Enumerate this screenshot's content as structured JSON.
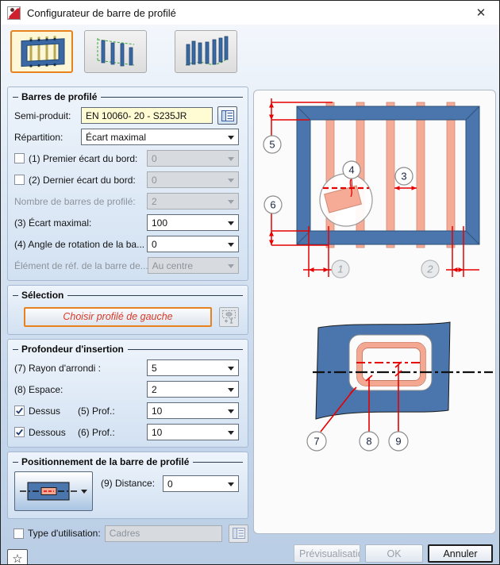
{
  "window": {
    "title": "Configurateur de barre de profilé"
  },
  "icons": {
    "close": "✕",
    "star": "☆"
  },
  "colors": {
    "accent_orange": "#E8821E",
    "frame_blue": "#4A76AD",
    "bar_pink": "#F6AB97",
    "dimension_red": "#E60000",
    "field_yellow": "#FFFBD2"
  },
  "form": {
    "group_bars": {
      "title": "Barres de profilé",
      "semi_product_label": "Semi-produit:",
      "semi_product_value": "EN 10060- 20 - S235JR",
      "repartition_label": "Répartition:",
      "repartition_value": "Écart maximal",
      "first_gap_label": "(1) Premier écart du bord:",
      "first_gap_value": "0",
      "last_gap_label": "(2) Dernier écart du bord:",
      "last_gap_value": "0",
      "count_label": "Nombre de barres de profilé:",
      "count_value": "2",
      "max_gap_label": "(3) Écart maximal:",
      "max_gap_value": "100",
      "angle_label": "(4) Angle de rotation de la ba...",
      "angle_value": "0",
      "ref_label": "Élément de réf. de la barre de...",
      "ref_value": "Au centre"
    },
    "group_selection": {
      "title": "Sélection",
      "choose_label": "Choisir profilé de gauche"
    },
    "group_depth": {
      "title": "Profondeur d'insertion",
      "radius_label": "(7) Rayon d'arrondi :",
      "radius_value": "5",
      "space_label": "(8) Espace:",
      "space_value": "2",
      "top_check_label": "Dessus",
      "top_depth_label": "(5) Prof.:",
      "top_depth_value": "10",
      "bottom_check_label": "Dessous",
      "bottom_depth_label": "(6) Prof.:",
      "bottom_depth_value": "10"
    },
    "group_position": {
      "title": "Positionnement de la barre de profilé",
      "distance_label": "(9) Distance:",
      "distance_value": "0"
    },
    "usage": {
      "label": "Type d'utilisation:",
      "value": "Cadres"
    }
  },
  "footer": {
    "preview_label": "Prévisualisatio",
    "ok_label": "OK",
    "cancel_label": "Annuler"
  },
  "diagram": {
    "callout_1": "1",
    "callout_2": "2",
    "callout_3": "3",
    "callout_4": "4",
    "callout_5": "5",
    "callout_6": "6",
    "callout_7": "7",
    "callout_8": "8",
    "callout_9": "9"
  }
}
